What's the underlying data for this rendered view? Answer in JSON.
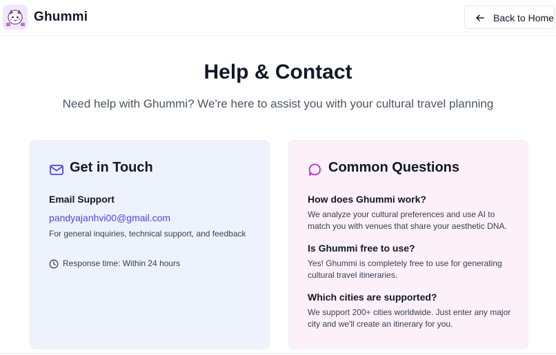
{
  "header": {
    "brand": "Ghummi",
    "back_label": "Back to Home",
    "logo_icon": "ghummi-mascot-logo",
    "back_icon": "arrow-left-icon"
  },
  "hero": {
    "title": "Help & Contact",
    "subtitle": "Need help with Ghummi? We're here to assist you with your cultural travel planning"
  },
  "contact": {
    "heading": "Get in Touch",
    "heading_icon": "mail-icon",
    "email_label": "Email Support",
    "email": "pandyajanhvi00@gmail.com",
    "email_desc": "For general inquiries, technical support, and feedback",
    "response_icon": "clock-icon",
    "response_time": "Response time: Within 24 hours"
  },
  "faq": {
    "heading": "Common Questions",
    "heading_icon": "chat-bubble-icon",
    "items": [
      {
        "question": "How does Ghummi work?",
        "answer_line1": "We analyze your cultural preferences and use AI to",
        "answer_line2": "match you with venues that share your aesthetic DNA."
      },
      {
        "question": "Is Ghummi free to use?",
        "answer_line1": "Yes! Ghummi is completely free to use for generating",
        "answer_line2": "cultural travel itineraries."
      },
      {
        "question": "Which cities are supported?",
        "answer_line1": "We support 200+ cities worldwide. Just enter any major",
        "answer_line2": "city and we'll create an itinerary for you."
      }
    ]
  },
  "colors": {
    "accent_link": "#4f46e5",
    "mail_icon": "#4f46e5",
    "chat_icon": "#c026d3",
    "contact_card_bg": "#edf2fd",
    "faq_card_bg": "#fcf0f9"
  }
}
